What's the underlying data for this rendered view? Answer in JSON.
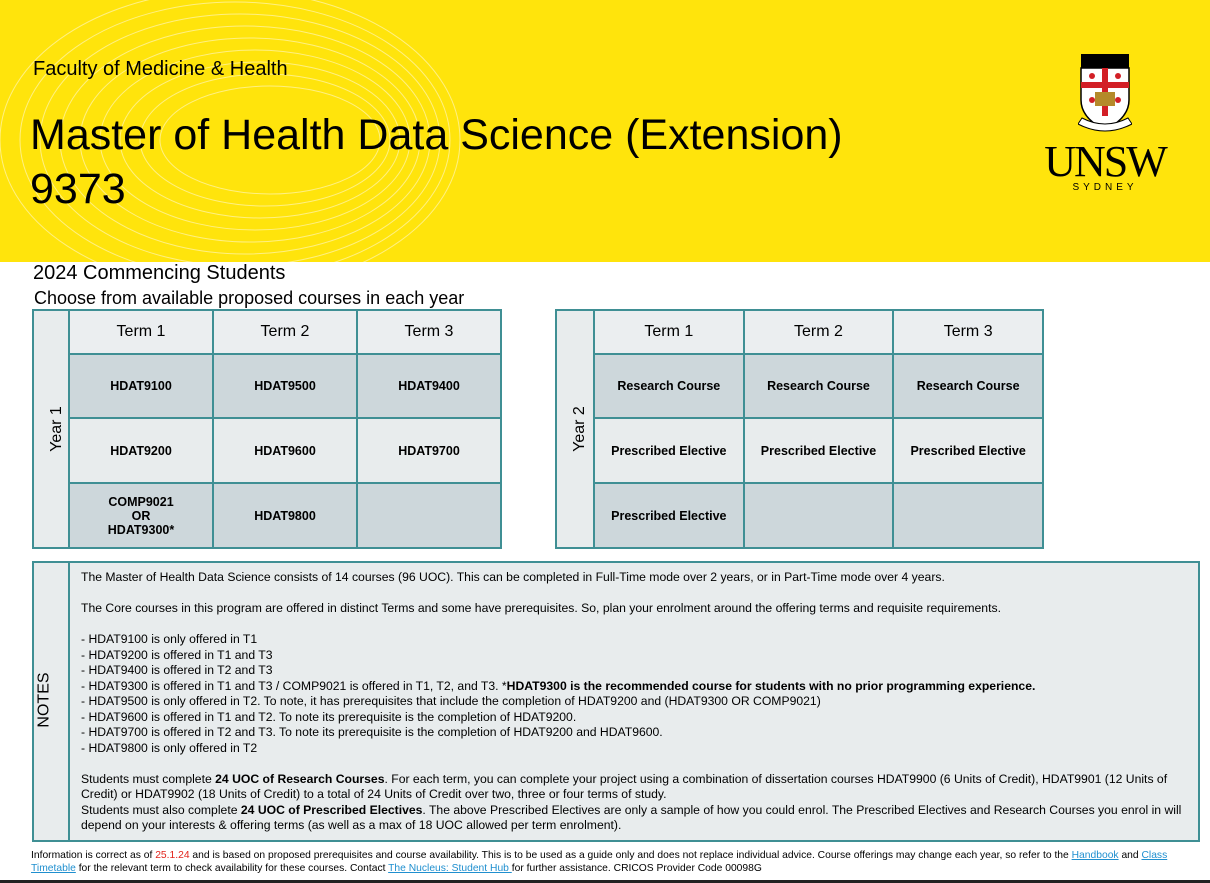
{
  "header": {
    "faculty": "Faculty of Medicine & Health",
    "title_line1": "Master of Health Data Science (Extension)",
    "title_line2": "9373",
    "logo_word": "UNSW",
    "logo_sub": "SYDNEY"
  },
  "subhead": {
    "line1": "2024 Commencing Students",
    "line2": "Choose from available proposed courses in each year"
  },
  "year1": {
    "label": "Year 1",
    "terms": [
      "Term 1",
      "Term 2",
      "Term 3"
    ],
    "rows": [
      [
        "HDAT9100",
        "HDAT9500",
        "HDAT9400"
      ],
      [
        "HDAT9200",
        "HDAT9600",
        "HDAT9700"
      ],
      [
        "COMP9021",
        "HDAT9800",
        ""
      ]
    ],
    "or_text": "OR",
    "alt_course": "HDAT9300*"
  },
  "year2": {
    "label": "Year 2",
    "terms": [
      "Term 1",
      "Term 2",
      "Term 3"
    ],
    "rows": [
      [
        "Research Course",
        "Research Course",
        "Research Course"
      ],
      [
        "Prescribed Elective",
        "Prescribed Elective",
        "Prescribed Elective"
      ],
      [
        "Prescribed Elective",
        "",
        ""
      ]
    ]
  },
  "notes": {
    "label": "NOTES",
    "p1": "The Master of Health Data Science consists of 14 courses (96 UOC). This can be completed in Full-Time mode over 2 years, or in Part-Time mode over 4 years.",
    "p2": "The Core courses in this program are offered in distinct Terms and some have prerequisites. So, plan your enrolment around the offering terms and requisite requirements.",
    "list": [
      "- HDAT9100 is only offered in T1",
      "- HDAT9200 is offered in T1 and T3",
      "- HDAT9400 is offered in T2 and T3",
      "- HDAT9300 is offered in T1 and T3 / COMP9021 is offered in T1, T2, and T3. *",
      "- HDAT9500 is only offered in T2. To note, it has prerequisites that include the completion of HDAT9200 and (HDAT9300 OR COMP9021)",
      "- HDAT9600 is offered in T1 and T2. To note its prerequisite is the completion of HDAT9200.",
      "- HDAT9700 is offered in T2 and T3. To note its prerequisite is the completion of HDAT9200 and HDAT9600.",
      "- HDAT9800 is only offered in T2"
    ],
    "list_bold": "HDAT9300 is the recommended course for students with no prior programming experience.",
    "p3_a": "Students must complete ",
    "p3_b": "24 UOC of Research Courses",
    "p3_c": ". For each term, you can complete your project using a combination of dissertation courses HDAT9900 (6 Units of Credit), HDAT9901 (12 Units of Credit) or HDAT9902 (18 Units of Credit) to a total of 24 Units of Credit over two, three or four terms of study.",
    "p4_a": "Students must also complete ",
    "p4_b": "24 UOC of Prescribed Electives",
    "p4_c": ". The above Prescribed Electives are only a sample of how you could enrol. The Prescribed Electives and Research Courses you enrol in will depend on your interests & offering terms (as well as a max of 18 UOC allowed per term enrolment)."
  },
  "footer": {
    "t1": "Information is correct as of ",
    "date": "25.1.24",
    "t2": " and is based on proposed prerequisites and course availability. This is to be used as a guide only and does not replace individual advice. Course offerings may change each year, so refer to the ",
    "link1": "Handbook",
    "t3": " and ",
    "link2": "Class Timetable",
    "t4": " for the relevant term to check availability for these courses. Contact ",
    "link3": "The Nucleus: Student Hub ",
    "t5": "for further assistance. CRICOS Provider Code 00098G"
  }
}
